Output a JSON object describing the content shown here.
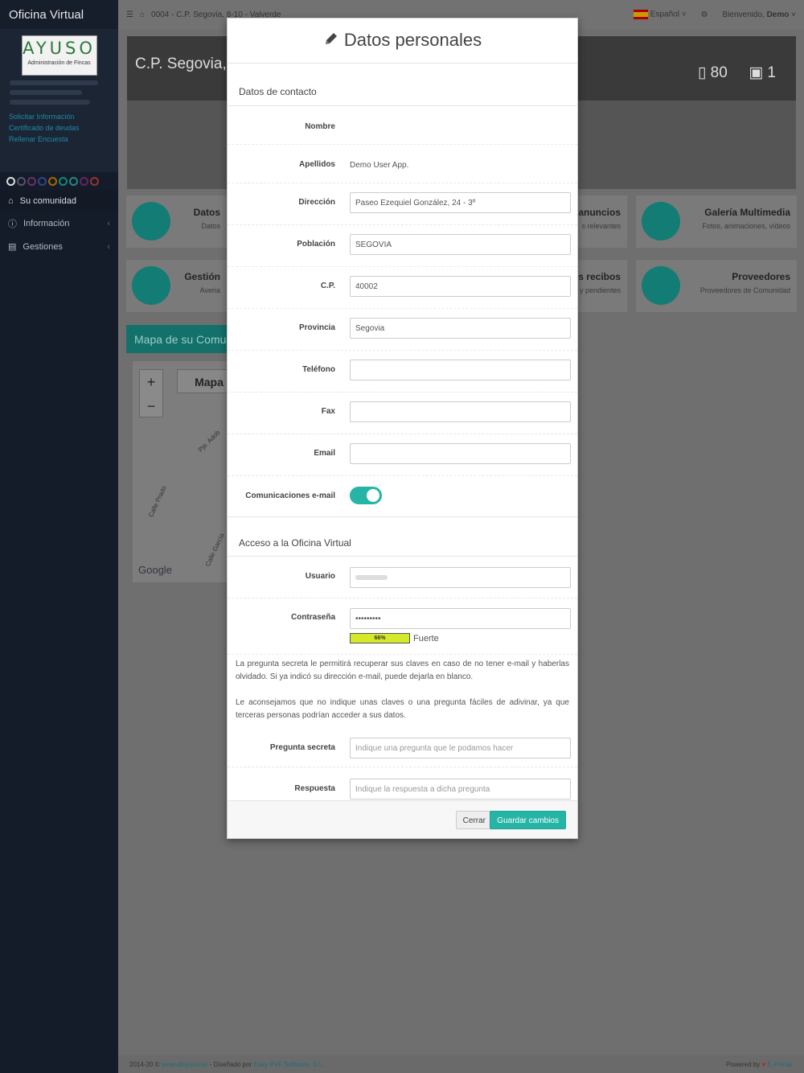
{
  "app": {
    "brand": "Oficina Virtual",
    "logo_title": "AYUSO",
    "logo_subtitle": "Administración de Fincas",
    "side_links": [
      "Solicitar Información",
      "Certificado de deudas",
      "Rellenar Encuesta"
    ],
    "nav": [
      {
        "label": "Su comunidad",
        "icon": "home-icon"
      },
      {
        "label": "Información",
        "icon": "info-icon"
      },
      {
        "label": "Gestiones",
        "icon": "briefcase-icon"
      }
    ],
    "breadcrumb": "0004 - C.P. Segovia, 8-10 - Valverde",
    "language": "Español",
    "welcome_prefix": "Bienvenido,",
    "welcome_user": "Demo",
    "banner_title": "C.P. Segovia,",
    "banner_docs": "80",
    "banner_images": "1",
    "cards": [
      {
        "title": "Datos",
        "subtitle": "Datos"
      },
      {
        "title": "anuncios",
        "subtitle": "s relevantes"
      },
      {
        "title": "Galería Multimedia",
        "subtitle": "Fotos, animaciones, vídeos"
      },
      {
        "title": "Gestión",
        "subtitle": "Averia"
      },
      {
        "title": "s recibos",
        "subtitle": "y pendientes"
      },
      {
        "title": "Proveedores",
        "subtitle": "Proveedores de Comunidad"
      }
    ],
    "map_title": "Mapa de su Comun",
    "map_type": "Mapa",
    "map_zoom_in": "+",
    "map_zoom_out": "−",
    "map_streets": [
      "Calle Prado",
      "Pje. Adob",
      "Calle García"
    ],
    "map_google": "Google",
    "footer_left_prefix": "2014-20 ©",
    "footer_left_link": "www.afayuso.es",
    "footer_left_mid": "- Diseñado por",
    "footer_left_link2": "Easy PVF Software, S.L.",
    "footer_right_prefix": "Powered by",
    "footer_right_link": "E-Fincas"
  },
  "modal": {
    "title": "Datos personales",
    "section_contact": "Datos de contacto",
    "fields": {
      "nombre_label": "Nombre",
      "nombre_value": "",
      "apellidos_label": "Apellidos",
      "apellidos_value": "Demo User App.",
      "direccion_label": "Dirección",
      "direccion_value": "Paseo Ezequiel González, 24 - 3º",
      "poblacion_label": "Población",
      "poblacion_value": "SEGOVIA",
      "cp_label": "C.P.",
      "cp_value": "40002",
      "provincia_label": "Provincia",
      "provincia_value": "Segovia",
      "telefono_label": "Teléfono",
      "telefono_value": "",
      "fax_label": "Fax",
      "fax_value": "",
      "email_label": "Email",
      "email_value": "",
      "comunicaciones_label": "Comunicaciones e-mail",
      "comunicaciones_on": true
    },
    "section_access": "Acceso a la Oficina Virtual",
    "usuario_label": "Usuario",
    "contrasena_label": "Contraseña",
    "contrasena_value": "•••••••••",
    "strength_percent": "66%",
    "strength_text": "Fuerte",
    "note1": "La pregunta secreta le permitirá recuperar sus claves en caso de no tener e-mail y haberlas olvidado. Si ya indicó su dirección e-mail, puede dejarla en blanco.",
    "note2": "Le aconsejamos que no indique unas claves o una pregunta fáciles de adivinar, ya que terceras personas podrían acceder a sus datos.",
    "pregunta_label": "Pregunta secreta",
    "pregunta_placeholder": "Indique una pregunta que le podamos hacer",
    "respuesta_label": "Respuesta",
    "respuesta_placeholder": "Indique la respuesta a dicha pregunta",
    "btn_close": "Cerrar",
    "btn_save": "Guardar cambios"
  },
  "colors": {
    "accent": "#26b4a7",
    "sidebar": "#141c29",
    "strength": "#d6e82a"
  }
}
